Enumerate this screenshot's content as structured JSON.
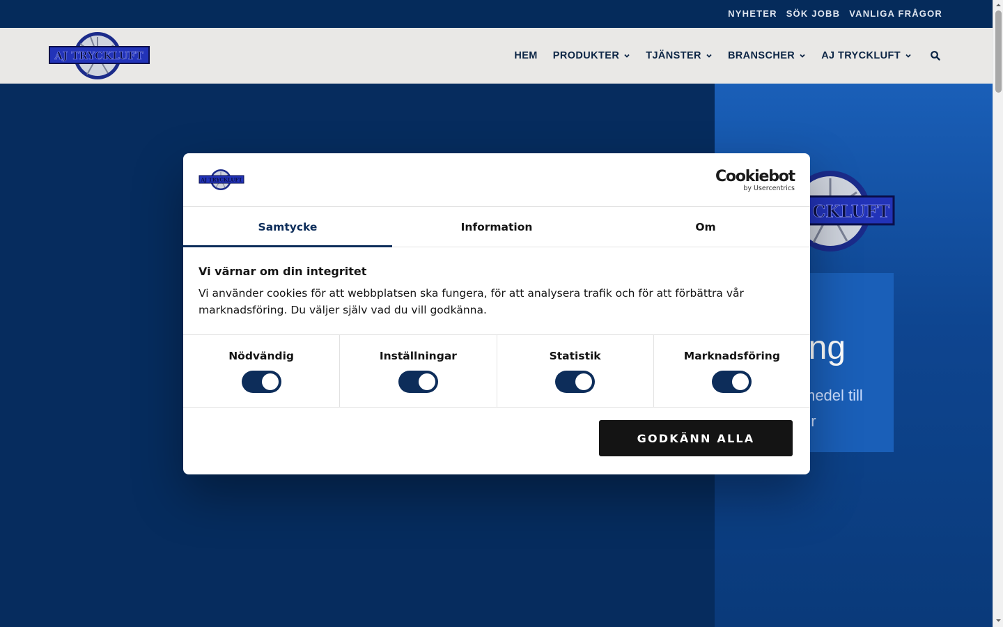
{
  "topbar": {
    "links": [
      "NYHETER",
      "SÖK JOBB",
      "VANLIGA FRÅGOR"
    ]
  },
  "header": {
    "logo_text": "AJ TRYCKLUFT",
    "nav": {
      "home": "HEM",
      "products": "PRODUKTER",
      "services": "TJÄNSTER",
      "industries": "BRANSCHER",
      "company": "AJ TRYCKLUFT"
    }
  },
  "hero": {
    "logo_text": "CKLUFT",
    "card_title": "ing",
    "card_line1": "medel till",
    "card_line2": "ur"
  },
  "cookie_dialog": {
    "logo_text": "AJ TRYCKLUFT",
    "brand": "Cookiebot",
    "brand_by": "by Usercentrics",
    "tabs": {
      "consent": "Samtycke",
      "information": "Information",
      "about": "Om"
    },
    "title": "Vi värnar om din integritet",
    "text": "Vi använder cookies för att webbplatsen ska fungera, för att analysera trafik och för att förbättra vår marknadsföring. Du väljer själv vad du vill godkänna.",
    "toggles": {
      "necessary": "Nödvändig",
      "preferences": "Inställningar",
      "statistics": "Statistik",
      "marketing": "Marknadsföring"
    },
    "toggle_states": {
      "necessary": true,
      "preferences": true,
      "statistics": true,
      "marketing": true
    },
    "accept_label": "GODKÄNN ALLA"
  },
  "colors": {
    "navy": "#062c5e",
    "accent_blue": "#1a5fb8",
    "toggle_on": "#0d2d5a",
    "button_dark": "#141414"
  }
}
